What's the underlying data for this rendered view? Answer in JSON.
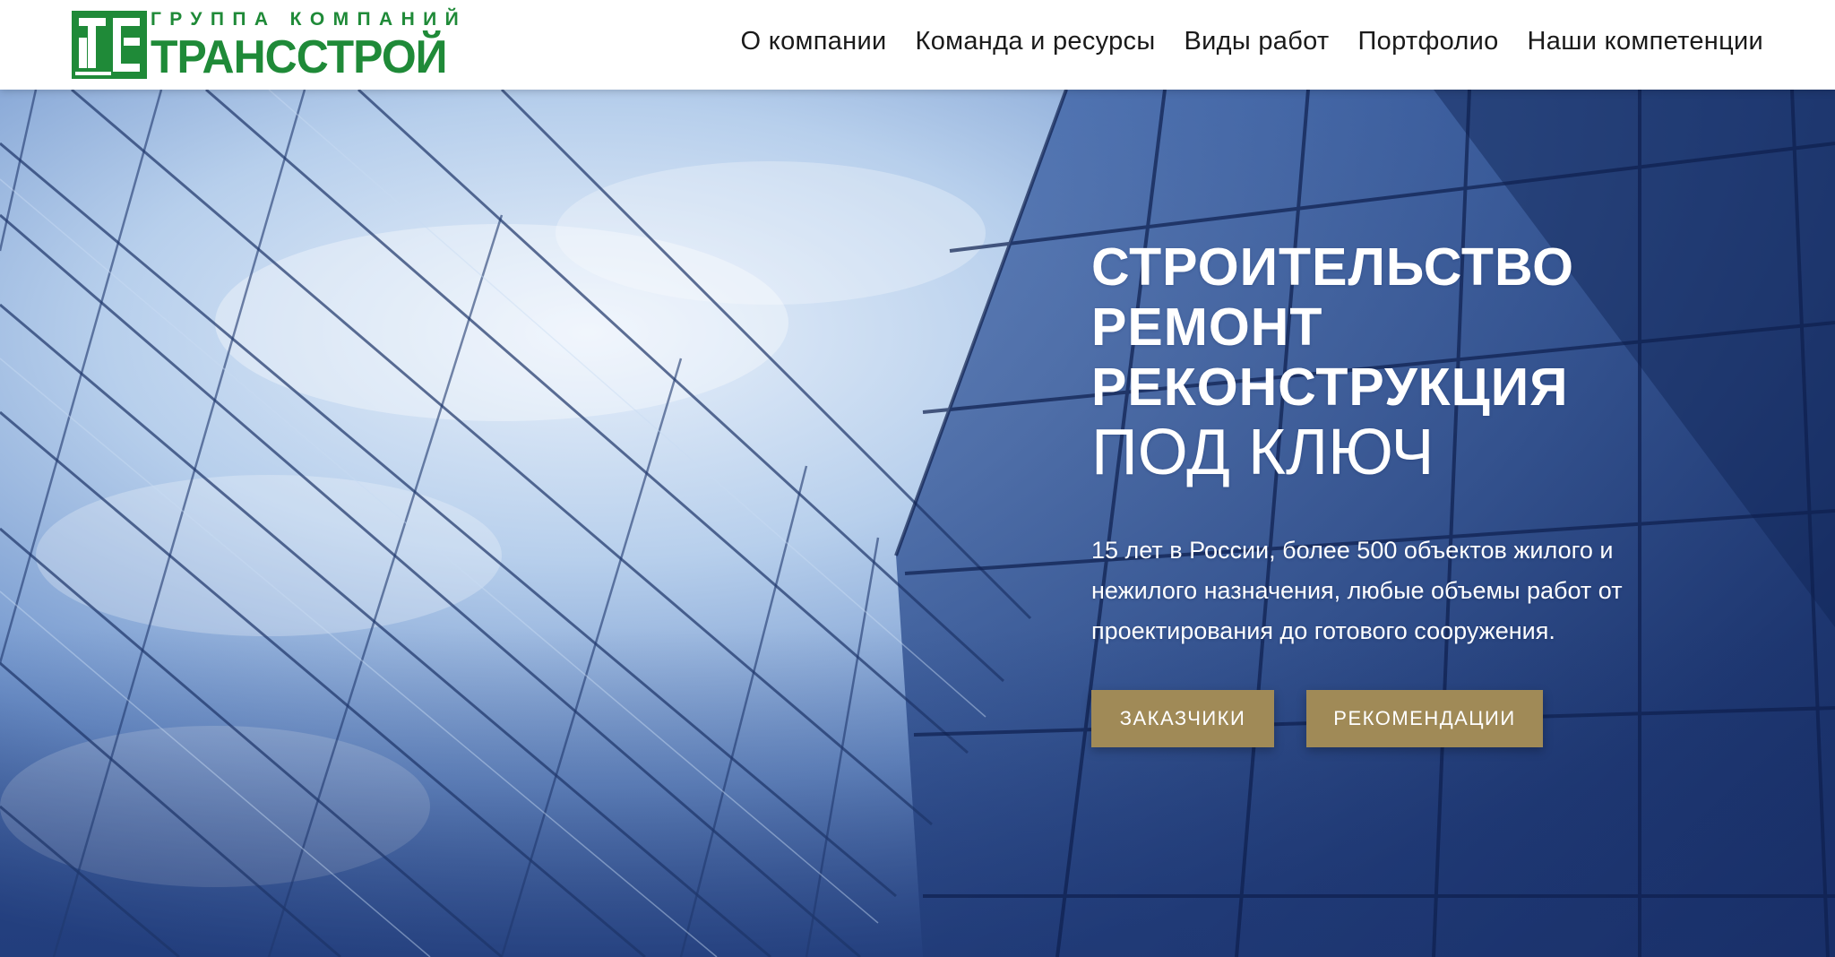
{
  "header": {
    "logo": {
      "mark_letters": "ТС",
      "tagline": "ГРУППА КОМПАНИЙ",
      "name": "ТРАНССТРОЙ"
    },
    "nav": [
      {
        "label": "О компании"
      },
      {
        "label": "Команда и ресурсы"
      },
      {
        "label": "Виды работ"
      },
      {
        "label": "Портфолио"
      },
      {
        "label": "Наши компетенции"
      }
    ]
  },
  "hero": {
    "headline": [
      "СТРОИТЕЛЬСТВО",
      "РЕМОНТ",
      "РЕКОНСТРУКЦИЯ"
    ],
    "headline_light": "ПОД КЛЮЧ",
    "description": "15 лет в России, более 500 объектов жилого и нежилого назначения, любые объемы работ от проектирования до готового сооружения.",
    "buttons": {
      "customers": "ЗАКАЗЧИКИ",
      "recommendations": "РЕКОМЕНДАЦИИ"
    }
  },
  "colors": {
    "brand_green": "#1f8a38",
    "button_gold": "#a08a57",
    "text_white": "#ffffff",
    "nav_text": "#1a1a1a"
  }
}
